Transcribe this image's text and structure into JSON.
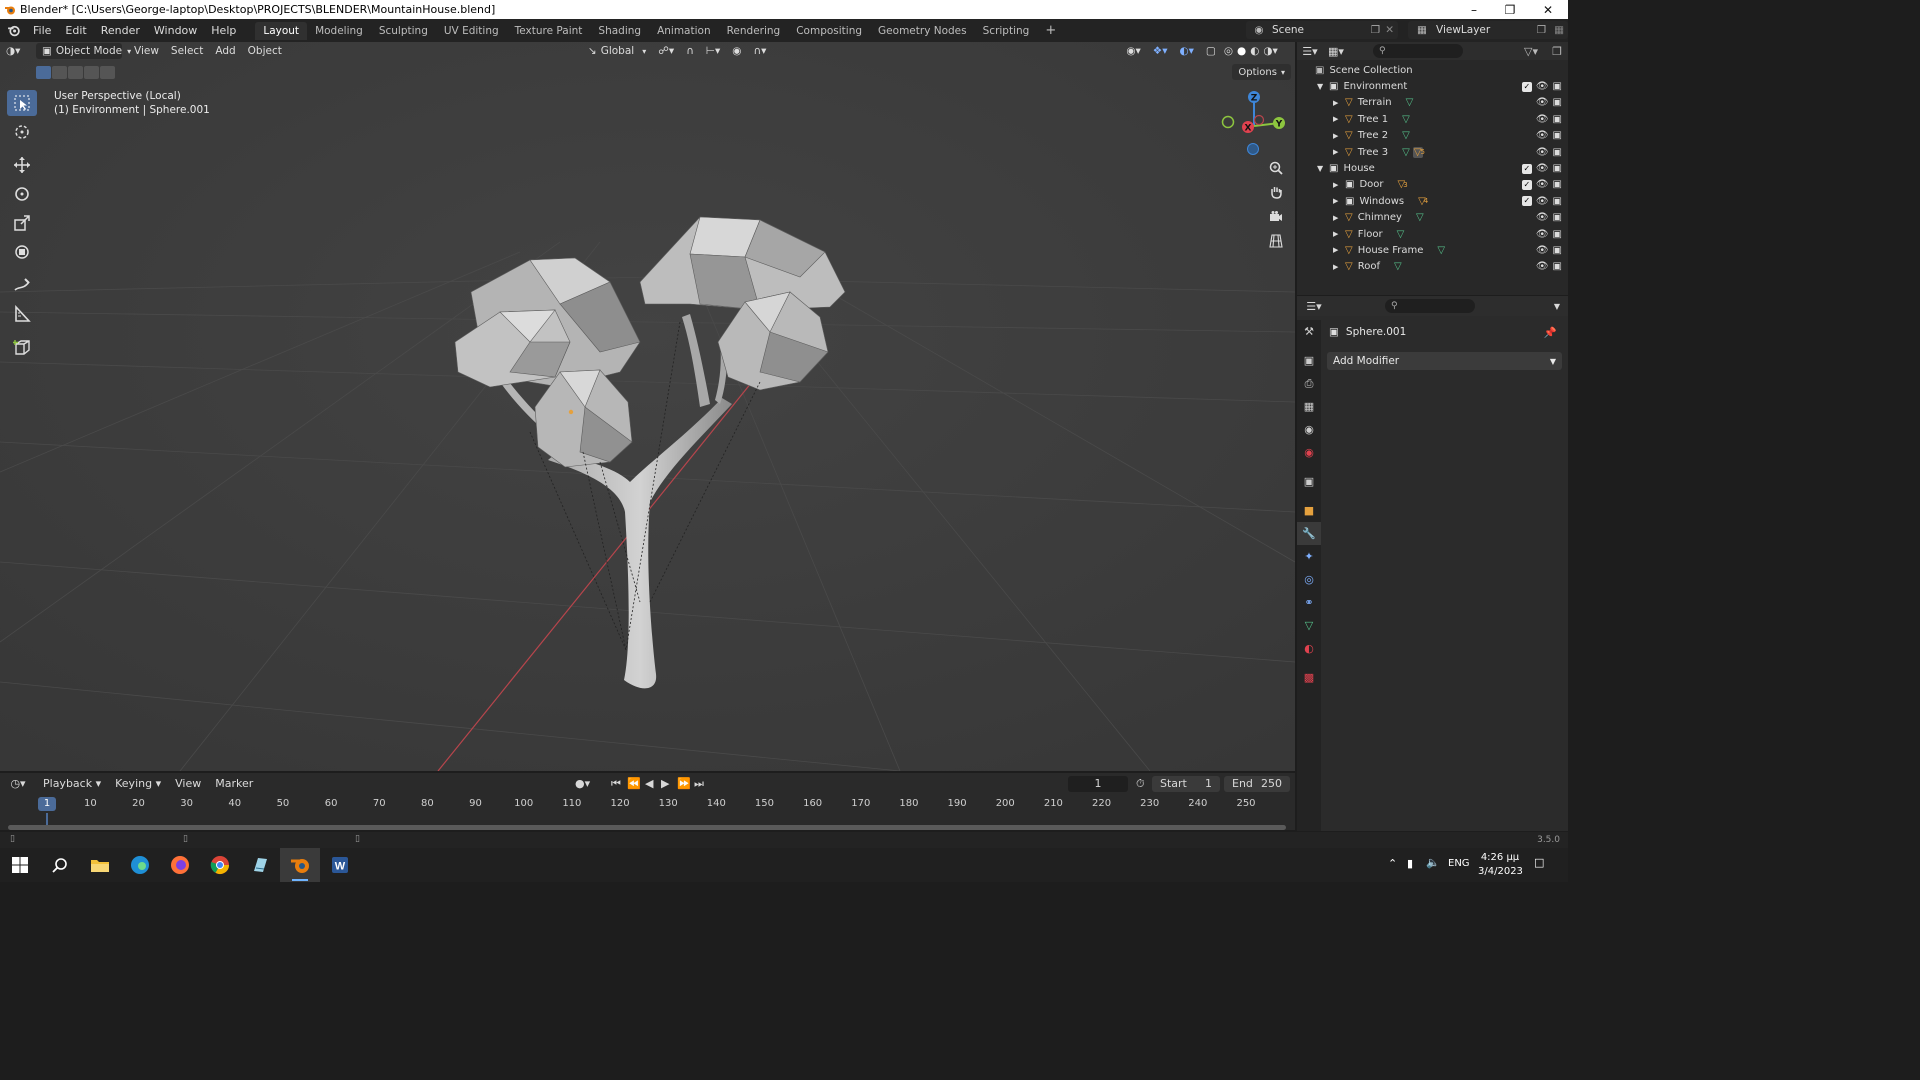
{
  "window": {
    "title": "Blender* [C:\\Users\\George-laptop\\Desktop\\PROJECTS\\BLENDER\\MountainHouse.blend]"
  },
  "menu": [
    "File",
    "Edit",
    "Render",
    "Window",
    "Help"
  ],
  "workspaces": [
    "Layout",
    "Modeling",
    "Sculpting",
    "UV Editing",
    "Texture Paint",
    "Shading",
    "Animation",
    "Rendering",
    "Compositing",
    "Geometry Nodes",
    "Scripting"
  ],
  "active_workspace": "Layout",
  "scene": {
    "name": "Scene",
    "view_layer": "ViewLayer"
  },
  "viewport": {
    "mode": "Object Mode",
    "menus": [
      "View",
      "Select",
      "Add",
      "Object"
    ],
    "transform_orientation": "Global",
    "perspective_label": "User Perspective (Local)",
    "selection_label": "(1) Environment | Sphere.001",
    "options_label": "Options",
    "gizmo_axes": [
      "X",
      "Y",
      "Z"
    ]
  },
  "outliner": {
    "root": "Scene Collection",
    "collections": [
      {
        "name": "Environment",
        "children": [
          {
            "name": "Terrain"
          },
          {
            "name": "Tree 1"
          },
          {
            "name": "Tree 2"
          },
          {
            "name": "Tree 3",
            "badge": "5"
          }
        ]
      },
      {
        "name": "House",
        "children": [
          {
            "name": "Door",
            "badge": "3"
          },
          {
            "name": "Windows",
            "badge": "4"
          },
          {
            "name": "Chimney"
          },
          {
            "name": "Floor"
          },
          {
            "name": "House Frame"
          },
          {
            "name": "Roof"
          }
        ]
      }
    ]
  },
  "properties": {
    "object_name": "Sphere.001",
    "add_modifier_label": "Add Modifier"
  },
  "timeline": {
    "menus": [
      "Playback",
      "Keying",
      "View",
      "Marker"
    ],
    "current_frame": "1",
    "start_label": "Start",
    "start": "1",
    "end_label": "End",
    "end": "250",
    "ruler": [
      "1",
      "10",
      "20",
      "30",
      "40",
      "50",
      "60",
      "70",
      "80",
      "90",
      "100",
      "110",
      "120",
      "130",
      "140",
      "150",
      "160",
      "170",
      "180",
      "190",
      "200",
      "210",
      "220",
      "230",
      "240",
      "250"
    ]
  },
  "status": {
    "version": "3.5.0"
  },
  "taskbar": {
    "language": "ENG",
    "time": "4:26 μμ",
    "date": "3/4/2023"
  },
  "colors": {
    "accent": "#4b6b99",
    "object_orange": "#e5a13e",
    "mesh_green": "#55c08a",
    "axis_x": "#e0424f",
    "axis_y": "#8dc53f",
    "axis_z": "#3e86d8"
  }
}
